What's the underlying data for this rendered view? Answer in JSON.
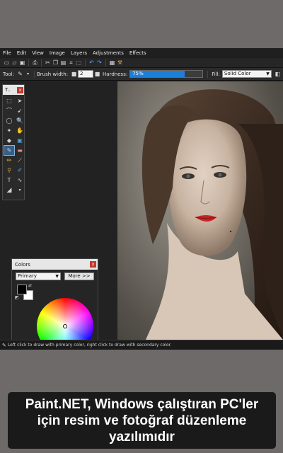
{
  "menubar": {
    "items": [
      "File",
      "Edit",
      "View",
      "Image",
      "Layers",
      "Adjustments",
      "Effects"
    ]
  },
  "toolbar": {
    "icons": [
      "new-icon",
      "open-icon",
      "save-icon",
      "print-icon",
      "cut-icon",
      "copy-icon",
      "paste-icon",
      "crop-icon",
      "deselect-icon",
      "undo-icon",
      "redo-icon",
      "grid-icon",
      "tools-icon"
    ]
  },
  "options": {
    "tool_label": "Tool:",
    "brush_width_label": "Brush width:",
    "brush_width_value": "2",
    "hardness_label": "Hardness:",
    "hardness_value": "75%",
    "hardness_level": 0.75,
    "fill_label": "Fill:",
    "fill_value": "Solid Color"
  },
  "tools_window": {
    "title": "T..",
    "close": "x"
  },
  "colors_window": {
    "title": "Colors",
    "close": "x",
    "mode_value": "Primary",
    "more_label": "More >>",
    "primary_color": "#000000",
    "secondary_color": "#ffffff"
  },
  "palette_colors": [
    "#000000",
    "#404040",
    "#ff0000",
    "#ff6a00",
    "#ffd800",
    "#b6ff00",
    "#4cff00",
    "#00ff21",
    "#00ff90",
    "#00ffff",
    "#0094ff",
    "#0026ff",
    "#4800ff",
    "#b200ff",
    "#ffffff",
    "#808080",
    "#7f0000",
    "#7f3300",
    "#7f6a00",
    "#5b7f00",
    "#267f00",
    "#007f0e",
    "#007f46",
    "#007f7f",
    "#004a7f",
    "#00137f",
    "#21007f",
    "#57007f"
  ],
  "statusbar": {
    "text": "Left click to draw with primary color, right click to draw with secondary color."
  },
  "caption": {
    "text": "Paint.NET, Windows çalıştıran PC'ler için resim ve fotoğraf düzenleme yazılımıdır"
  }
}
